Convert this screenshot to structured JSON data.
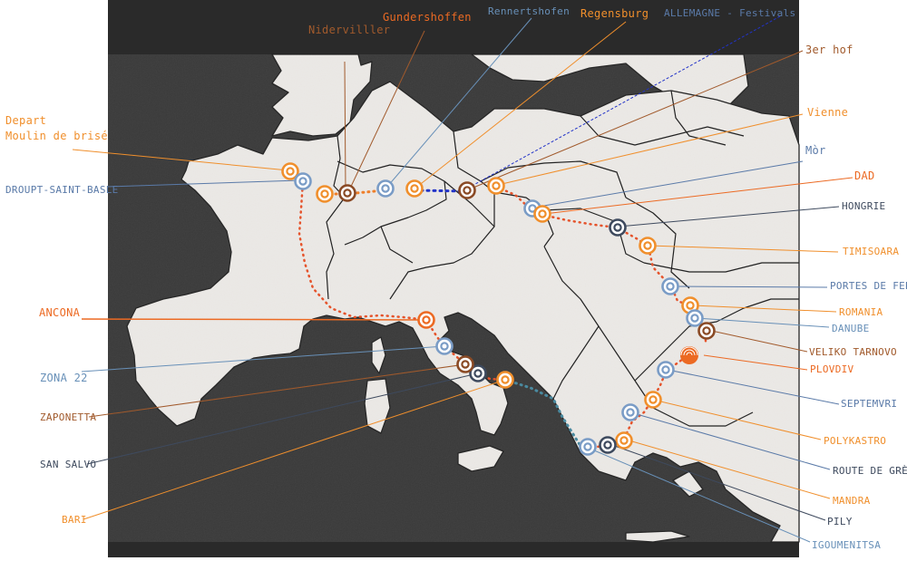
{
  "map": {
    "colors": {
      "land": "#ece9e6",
      "sea": "#3a3a3a",
      "frame": "#2a2a2a",
      "orange": "#f08f2c",
      "red": "#ec6a23",
      "blue": "#7a9cc6",
      "navy": "#3e4a5e",
      "brown": "#8a4a25",
      "teal": "#4a8aa0",
      "bluedot": "#2233c8"
    },
    "route_stops": [
      {
        "name": "Depart Moulin de brisé",
        "color": "orange",
        "marker": "ring"
      },
      {
        "name": "DROUPT-SAINT-BASLE",
        "color": "blue",
        "marker": "ring"
      },
      {
        "name": "Nidervilller",
        "color": "brown",
        "marker": "ring"
      },
      {
        "name": "Gundershoffen",
        "color": "orange",
        "marker": "ring"
      },
      {
        "name": "Rennertshofen",
        "color": "blue",
        "marker": "ring"
      },
      {
        "name": "Regensburg",
        "color": "orange",
        "marker": "ring"
      },
      {
        "name": "3er hof",
        "color": "brown",
        "marker": "ring"
      },
      {
        "name": "Vienne",
        "color": "orange",
        "marker": "ring"
      },
      {
        "name": "Mòr",
        "color": "blue",
        "marker": "ring"
      },
      {
        "name": "DAD",
        "color": "orange",
        "marker": "ring"
      },
      {
        "name": "HONGRIE",
        "color": "navy",
        "marker": "ring"
      },
      {
        "name": "TIMISOARA",
        "color": "orange",
        "marker": "ring"
      },
      {
        "name": "PORTES DE FER",
        "color": "blue",
        "marker": "ring"
      },
      {
        "name": "ROMANIA",
        "color": "orange",
        "marker": "ring"
      },
      {
        "name": "DANUBE",
        "color": "blue",
        "marker": "ring"
      },
      {
        "name": "VELIKO TARNOVO",
        "color": "brown",
        "marker": "ring"
      },
      {
        "name": "PLOVDIV",
        "color": "red",
        "marker": "festival"
      },
      {
        "name": "SEPTEMVRI",
        "color": "blue",
        "marker": "ring"
      },
      {
        "name": "POLYKASTRO",
        "color": "orange",
        "marker": "ring"
      },
      {
        "name": "ROUTE DE GRÈCE",
        "color": "blue",
        "marker": "ring"
      },
      {
        "name": "MANDRA",
        "color": "orange",
        "marker": "ring"
      },
      {
        "name": "PILY",
        "color": "navy",
        "marker": "ring"
      },
      {
        "name": "IGOUMENITSA",
        "color": "blue",
        "marker": "ring"
      },
      {
        "name": "BARI",
        "color": "orange",
        "marker": "ring"
      },
      {
        "name": "SAN SALVO",
        "color": "navy",
        "marker": "ring"
      },
      {
        "name": "ZAPONETTA",
        "color": "brown",
        "marker": "ring"
      },
      {
        "name": "ZONA 22",
        "color": "blue",
        "marker": "ring"
      },
      {
        "name": "ANCONA",
        "color": "red",
        "marker": "ring"
      }
    ],
    "labels": {
      "depart_line1": "Depart",
      "depart_line2": "Moulin de brisé",
      "droupt": "DROUPT-SAINT-BASLE",
      "niderviller": "Nidervilller",
      "gundershoffen": "Gundershoffen",
      "rennertshofen": "Rennertshofen",
      "regensburg": "Regensburg",
      "allemagne": "ALLEMAGNE - Festivals",
      "drei_hof": "3er hof",
      "vienne": "Vienne",
      "mor": "Mòr",
      "dad": "DAD",
      "hongrie": "HONGRIE",
      "timisoara": "TIMISOARA",
      "portes_de_fer": "PORTES DE FER",
      "romania": "ROMANIA",
      "danube": "DANUBE",
      "veliko": "VELIKO TARNOVO",
      "plovdiv": "PLOVDIV",
      "septemvri": "SEPTEMVRI",
      "polykastro": "POLYKASTRO",
      "route_grece": "ROUTE DE GRÈCE",
      "mandra": "MANDRA",
      "pily": "PILY",
      "igoumenitsa": "IGOUMENITSA",
      "ancona": "ANCONA",
      "zona22": "ZONA 22",
      "zaponetta": "ZAPONETTA",
      "san_salvo": "SAN SALVO",
      "bari": "BARI"
    }
  }
}
